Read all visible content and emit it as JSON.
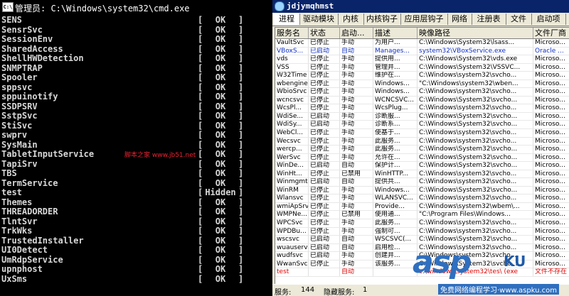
{
  "cmd": {
    "title": "管理员: C:\\Windows\\system32\\cmd.exe",
    "icon": "C:\\",
    "watermark": "脚本之家 www.jb51.net",
    "lines": [
      {
        "name": "SENS",
        "open": "[",
        "status": "OK",
        "close": "]"
      },
      {
        "name": "SensrSvc",
        "open": "[",
        "status": "OK",
        "close": "]"
      },
      {
        "name": "SessionEnv",
        "open": "[",
        "status": "OK",
        "close": "]"
      },
      {
        "name": "SharedAccess",
        "open": "[",
        "status": "OK",
        "close": "]"
      },
      {
        "name": "ShellHWDetection",
        "open": "[",
        "status": "OK",
        "close": "]"
      },
      {
        "name": "SNMPTRAP",
        "open": "[",
        "status": "OK",
        "close": "]"
      },
      {
        "name": "Spooler",
        "open": "[",
        "status": "OK",
        "close": "]"
      },
      {
        "name": "sppsvc",
        "open": "[",
        "status": "OK",
        "close": "]"
      },
      {
        "name": "sppuinotify",
        "open": "[",
        "status": "OK",
        "close": "]"
      },
      {
        "name": "SSDPSRV",
        "open": "[",
        "status": "OK",
        "close": "]"
      },
      {
        "name": "SstpSvc",
        "open": "[",
        "status": "OK",
        "close": "]"
      },
      {
        "name": "StiSvc",
        "open": "[",
        "status": "OK",
        "close": "]"
      },
      {
        "name": "swprv",
        "open": "[",
        "status": "OK",
        "close": "]"
      },
      {
        "name": "SysMain",
        "open": "[",
        "status": "OK",
        "close": "]"
      },
      {
        "name": "TabletInputService",
        "open": "[",
        "status": "OK",
        "close": "]"
      },
      {
        "name": "TapiSrv",
        "open": "[",
        "status": "OK",
        "close": "]"
      },
      {
        "name": "TBS",
        "open": "[",
        "status": "OK",
        "close": "]"
      },
      {
        "name": "TermService",
        "open": "[",
        "status": "OK",
        "close": "]"
      },
      {
        "name": "test",
        "open": "[",
        "status": "Hidden",
        "close": "]"
      },
      {
        "name": "Themes",
        "open": "[",
        "status": "OK",
        "close": "]"
      },
      {
        "name": "THREADORDER",
        "open": "[",
        "status": "OK",
        "close": "]"
      },
      {
        "name": "TlntSvr",
        "open": "[",
        "status": "OK",
        "close": "]"
      },
      {
        "name": "TrkWks",
        "open": "[",
        "status": "OK",
        "close": "]"
      },
      {
        "name": "TrustedInstaller",
        "open": "[",
        "status": "OK",
        "close": "]"
      },
      {
        "name": "UI0Detect",
        "open": "[",
        "status": "OK",
        "close": "]"
      },
      {
        "name": "UmRdpService",
        "open": "[",
        "status": "OK",
        "close": "]"
      },
      {
        "name": "upnphost",
        "open": "[",
        "status": "OK",
        "close": "]"
      },
      {
        "name": "UxSms",
        "open": "[",
        "status": "OK",
        "close": "]"
      }
    ]
  },
  "win": {
    "title": "jdjymqhmst",
    "tabs": [
      {
        "label": "进程",
        "w": 36
      },
      {
        "label": "驱动模块",
        "w": 54
      },
      {
        "label": "内核",
        "w": 36
      },
      {
        "label": "内核钩子",
        "w": 52
      },
      {
        "label": "应用层钩子",
        "w": 66
      },
      {
        "label": "网络",
        "w": 34
      },
      {
        "label": "注册表",
        "w": 48
      },
      {
        "label": "文件",
        "w": 36
      },
      {
        "label": "启动项",
        "w": 48
      }
    ],
    "columns": [
      {
        "label": "服务名",
        "w": 47
      },
      {
        "label": "状态",
        "w": 44
      },
      {
        "label": "启动...",
        "w": 47
      },
      {
        "label": "描述",
        "w": 62
      },
      {
        "label": "映像路径",
        "w": 163
      },
      {
        "label": "文件厂商",
        "w": 52
      }
    ],
    "rows": [
      {
        "c": [
          "VaultSvc",
          "已停止",
          "手动",
          "为用户...",
          "C:\\Windows\\System32\\lsass...",
          "Microso..."
        ],
        "t": ""
      },
      {
        "c": [
          "VBoxS...",
          "已启动",
          "自动",
          "Manages...",
          "system32\\VBoxService.exe",
          "Oracle ..."
        ],
        "t": "blue"
      },
      {
        "c": [
          "vds",
          "已停止",
          "手动",
          "提供用...",
          "C:\\Windows\\System32\\vds.exe",
          "Microso..."
        ],
        "t": ""
      },
      {
        "c": [
          "VSS",
          "已停止",
          "手动",
          "管理并...",
          "C:\\Windows\\System32\\VSSVC...",
          "Microso..."
        ],
        "t": ""
      },
      {
        "c": [
          "W32Time",
          "已停止",
          "手动",
          "维护在...",
          "C:\\Windows\\system32\\svcho...",
          "Microso..."
        ],
        "t": ""
      },
      {
        "c": [
          "wbengine",
          "已停止",
          "手动",
          "Windows...",
          "\"C:\\Windows\\system32\\wben...",
          "Microso..."
        ],
        "t": ""
      },
      {
        "c": [
          "WbioSrvc",
          "已停止",
          "手动",
          "Windows...",
          "C:\\Windows\\system32\\svcho...",
          "Microso..."
        ],
        "t": ""
      },
      {
        "c": [
          "wcncsvc",
          "已停止",
          "手动",
          "WCNCSVC...",
          "C:\\Windows\\System32\\svcho...",
          "Microso..."
        ],
        "t": ""
      },
      {
        "c": [
          "WcsPl...",
          "已停止",
          "手动",
          "WcsPlug...",
          "C:\\Windows\\system32\\svcho...",
          "Microso..."
        ],
        "t": ""
      },
      {
        "c": [
          "WdiSe...",
          "已启动",
          "手动",
          "诊断服...",
          "C:\\Windows\\System32\\svcho...",
          "Microso..."
        ],
        "t": ""
      },
      {
        "c": [
          "WdiSy...",
          "已启动",
          "手动",
          "诊断系...",
          "C:\\Windows\\System32\\svcho...",
          "Microso..."
        ],
        "t": ""
      },
      {
        "c": [
          "WebCl...",
          "已停止",
          "手动",
          "使基于...",
          "C:\\Windows\\system32\\svcho...",
          "Microso..."
        ],
        "t": ""
      },
      {
        "c": [
          "Wecsvc",
          "已停止",
          "手动",
          "此服务...",
          "C:\\Windows\\system32\\svcho...",
          "Microso..."
        ],
        "t": ""
      },
      {
        "c": [
          "wercp...",
          "已停止",
          "手动",
          "此服务...",
          "C:\\Windows\\System32\\svcho...",
          "Microso..."
        ],
        "t": ""
      },
      {
        "c": [
          "WerSvc",
          "已停止",
          "手动",
          "允许在...",
          "C:\\Windows\\System32\\svcho...",
          "Microso..."
        ],
        "t": ""
      },
      {
        "c": [
          "WinDe...",
          "已启动",
          "自动",
          "保护计...",
          "C:\\Windows\\System32\\svcho...",
          "Microso..."
        ],
        "t": ""
      },
      {
        "c": [
          "WinHt...",
          "已停止",
          "已禁用",
          "WinHTTP...",
          "C:\\Windows\\system32\\svcho...",
          "Microso..."
        ],
        "t": ""
      },
      {
        "c": [
          "Winmgmt",
          "已启动",
          "自动",
          "提供共...",
          "C:\\Windows\\system32\\svcho...",
          "Microso..."
        ],
        "t": ""
      },
      {
        "c": [
          "WinRM",
          "已停止",
          "手动",
          "Windows...",
          "C:\\Windows\\System32\\svcho...",
          "Microso..."
        ],
        "t": ""
      },
      {
        "c": [
          "Wlansvc",
          "已停止",
          "手动",
          "WLANSVC...",
          "C:\\Windows\\system32\\svcho...",
          "Microso..."
        ],
        "t": ""
      },
      {
        "c": [
          "wmiApSrv",
          "已停止",
          "手动",
          "Provide...",
          "C:\\Windows\\system32\\wbem\\...",
          "Microso..."
        ],
        "t": ""
      },
      {
        "c": [
          "WMPNe...",
          "已停止",
          "已禁用",
          "使用通...",
          "\"C:\\Program Files\\Windows...",
          "Microso..."
        ],
        "t": ""
      },
      {
        "c": [
          "WPCSvc",
          "已停止",
          "手动",
          "此服务...",
          "C:\\Windows\\system32\\svcho...",
          "Microso..."
        ],
        "t": ""
      },
      {
        "c": [
          "WPDBu...",
          "已停止",
          "手动",
          "强制可...",
          "C:\\Windows\\system32\\svcho...",
          "Microso..."
        ],
        "t": ""
      },
      {
        "c": [
          "wscsvc",
          "已启动",
          "自动",
          "WSCSVC(...",
          "C:\\Windows\\System32\\svcho...",
          "Microso..."
        ],
        "t": ""
      },
      {
        "c": [
          "wuauserv",
          "已启动",
          "自动",
          "启用检...",
          "C:\\Windows\\system32\\svcho...",
          "Microso..."
        ],
        "t": ""
      },
      {
        "c": [
          "wudfsvc",
          "已启动",
          "手动",
          "创建并...",
          "C:\\Windows\\system32\\svcho...",
          "Microso..."
        ],
        "t": ""
      },
      {
        "c": [
          "WwanSvc",
          "已停止",
          "手动",
          "该服务...",
          "C:\\Windows\\System32\\svcho...",
          "Microso..."
        ],
        "t": ""
      },
      {
        "c": [
          "test",
          "",
          "自动",
          "",
          "c:\\windows\\system32\\tes\\ (exe",
          "文件不存在"
        ],
        "t": "red"
      }
    ],
    "status": {
      "services_label": "服务:",
      "services_value": "144",
      "hidden_label": "隐藏服务:",
      "hidden_value": "1"
    }
  },
  "logo": {
    "text": "asp",
    "suffix": "KU",
    "tagline": "免费网络编程学习·www.aspku.com"
  }
}
